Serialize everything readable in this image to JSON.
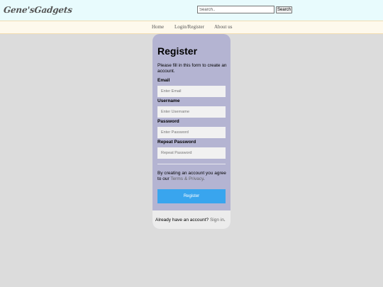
{
  "header": {
    "logo": "Gene'sGadgets",
    "search_placeholder": "Search..",
    "search_button": "Search"
  },
  "nav": {
    "items": [
      "Home",
      "Login/Register",
      "About us"
    ]
  },
  "form": {
    "title": "Register",
    "subtitle": "Please fill in this form to create an account.",
    "fields": [
      {
        "label": "Email",
        "placeholder": "Enter Email"
      },
      {
        "label": "Username",
        "placeholder": "Enter Username"
      },
      {
        "label": "Password",
        "placeholder": "Enter Password"
      },
      {
        "label": "Repeat Password",
        "placeholder": "Repeat Password"
      }
    ],
    "terms_prefix": "By creating an account you agree to our ",
    "terms_link": "Terms & Privacy",
    "terms_suffix": ".",
    "submit": "Register",
    "signin_prefix": "Already have an account? ",
    "signin_link": "Sign in",
    "signin_suffix": "."
  },
  "colors": {
    "header_bg": "#e8fbfd",
    "nav_bg": "#fef9ec",
    "card_bg": "#b4b4d2",
    "button_bg": "#39a5ee",
    "page_bg": "#dcdcdc"
  }
}
